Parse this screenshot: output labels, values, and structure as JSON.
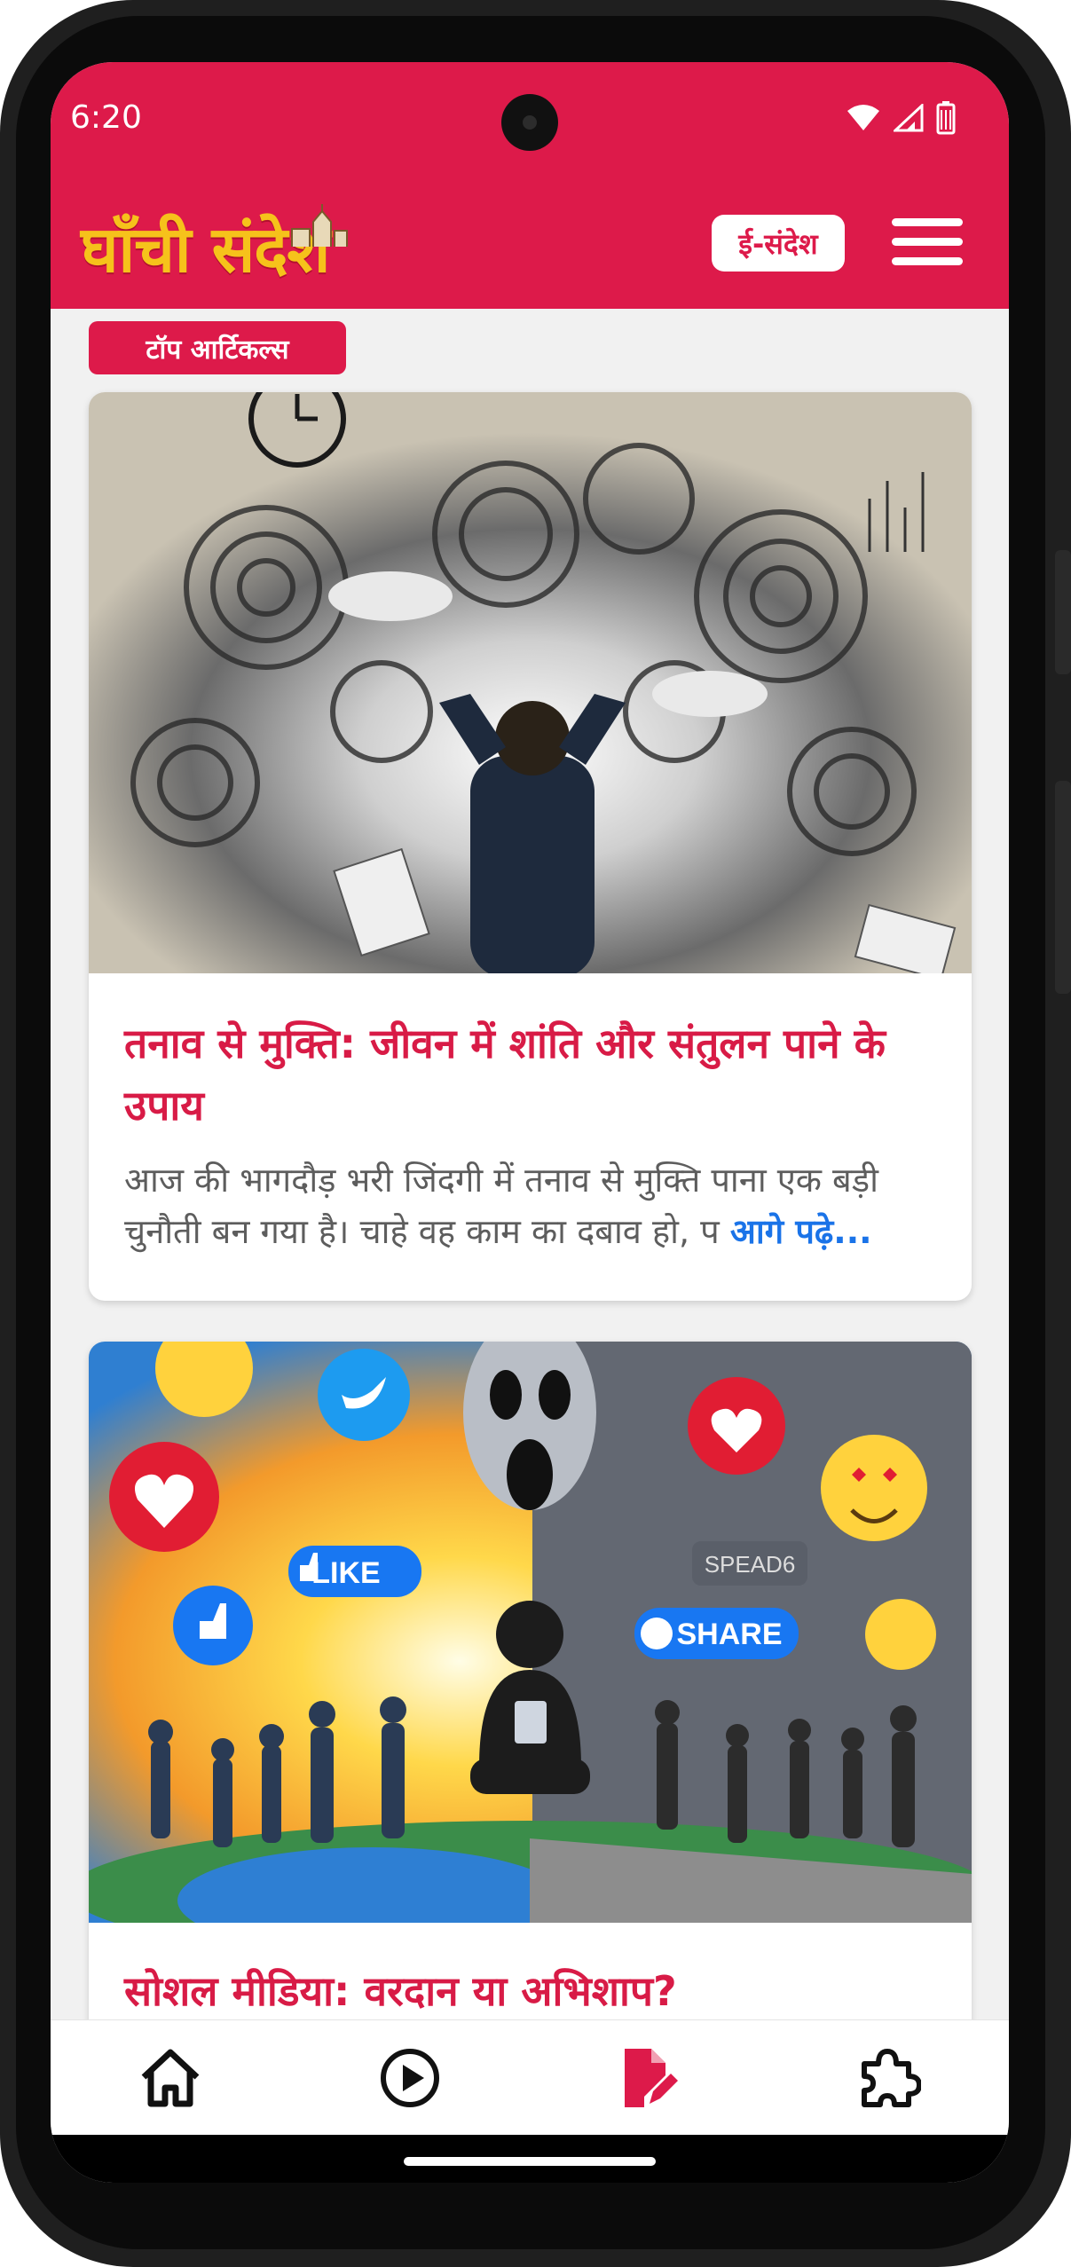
{
  "status_bar": {
    "time": "6:20"
  },
  "header": {
    "logo_text": "घाँची संदेश",
    "esandesh_label": "ई-संदेश"
  },
  "section": {
    "label": "टॉप आर्टिकल्स"
  },
  "articles": [
    {
      "title": "तनाव से मुक्ति: जीवन में शांति और संतुलन पाने के उपाय",
      "excerpt": "आज की भागदौड़ भरी जिंदगी में तनाव से मुक्ति पाना एक बड़ी चुनौती बन गया है। चाहे वह काम का दबाव हो, प",
      "read_more": "आगे पढ़े..."
    },
    {
      "title": "सोशल मीडिया: वरदान या अभिशाप?",
      "image_labels": {
        "like": "LIKE",
        "share": "SHARE",
        "spread": "SPEAD6"
      }
    }
  ],
  "bottom_nav": [
    {
      "icon": "home-icon"
    },
    {
      "icon": "play-icon"
    },
    {
      "icon": "edit-note-icon",
      "active": true
    },
    {
      "icon": "puzzle-icon"
    }
  ],
  "colors": {
    "brand_red": "#dd1a4a",
    "logo_yellow": "#f6c21b",
    "link_blue": "#1a73e8",
    "active_nav": "#dd1a4a"
  }
}
